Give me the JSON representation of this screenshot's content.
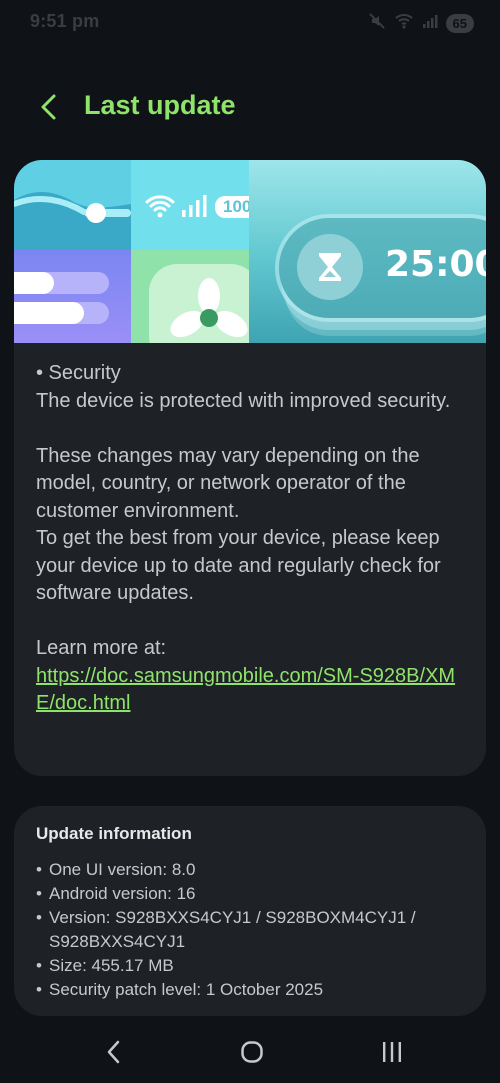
{
  "status_bar": {
    "time": "9:51 pm",
    "battery": "65",
    "icons": [
      "mute-icon",
      "wifi-calling-icon",
      "signal-icon",
      "battery-icon"
    ]
  },
  "header": {
    "title": "Last update",
    "back_icon": "chevron-left-icon"
  },
  "banner": {
    "wifi_badge": "100",
    "timer": "25:00",
    "icons": [
      "wifi-icon",
      "signal-bars-icon",
      "hourglass-icon",
      "fan-icon"
    ]
  },
  "release_notes": {
    "security_heading": "• Security",
    "security_text": "The device is protected with improved security.",
    "variation_text": "These changes may vary depending on the model, country, or network operator of the customer environment.",
    "advice_text": "To get the best from your device, please keep your device up to date and regularly check for software updates.",
    "learn_more_label": "Learn more at:",
    "learn_more_link": "https://doc.samsungmobile.com/SM-S928B/XME/doc.html"
  },
  "update_info": {
    "heading": "Update information",
    "one_ui": "One UI version: 8.0",
    "android": "Android version: 16",
    "version": "Version: S928BXXS4CYJ1 / S928BOXM4CYJ1 / S928BXXS4CYJ1",
    "size": "Size: 455.17 MB",
    "security_patch": "Security patch level: 1 October 2025"
  },
  "nav_bar": {
    "icons": [
      "back-icon",
      "home-icon",
      "recents-icon"
    ]
  },
  "colors": {
    "background": "#0f1216",
    "card": "#1e2226",
    "accent": "#8fe36a",
    "text": "#c6c8cc"
  }
}
